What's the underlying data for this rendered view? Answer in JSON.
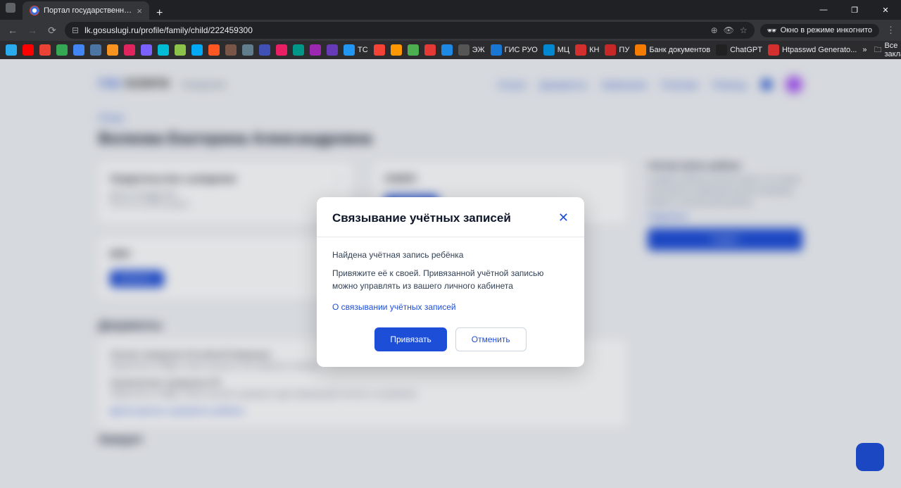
{
  "browser": {
    "tab_title": "Портал государственных услу",
    "url": "lk.gosuslugi.ru/profile/family/child/222459300",
    "incognito_label": "Окно в режиме инкогнито",
    "all_bookmarks": "Все закладки"
  },
  "bookmarks": [
    {
      "label": "",
      "color": "#2aabee"
    },
    {
      "label": "",
      "color": "#ff0000"
    },
    {
      "label": "",
      "color": "#ea4335"
    },
    {
      "label": "",
      "color": "#34a853"
    },
    {
      "label": "",
      "color": "#4285f4"
    },
    {
      "label": "",
      "color": "#4c75a3"
    },
    {
      "label": "",
      "color": "#f7931e"
    },
    {
      "label": "",
      "color": "#e0245e"
    },
    {
      "label": "",
      "color": "#7b61ff"
    },
    {
      "label": "",
      "color": "#00bcd4"
    },
    {
      "label": "",
      "color": "#8bc34a"
    },
    {
      "label": "",
      "color": "#03a9f4"
    },
    {
      "label": "",
      "color": "#ff5722"
    },
    {
      "label": "",
      "color": "#795548"
    },
    {
      "label": "",
      "color": "#607d8b"
    },
    {
      "label": "",
      "color": "#3f51b5"
    },
    {
      "label": "",
      "color": "#e91e63"
    },
    {
      "label": "",
      "color": "#009688"
    },
    {
      "label": "",
      "color": "#9c27b0"
    },
    {
      "label": "",
      "color": "#673ab7"
    },
    {
      "label": "TC",
      "color": "#2196f3"
    },
    {
      "label": "",
      "color": "#f44336"
    },
    {
      "label": "",
      "color": "#ff9800"
    },
    {
      "label": "",
      "color": "#4caf50"
    },
    {
      "label": "",
      "color": "#e53935"
    },
    {
      "label": "",
      "color": "#1e88e5"
    },
    {
      "label": "ЭЖ",
      "color": ""
    },
    {
      "label": "ГИС РУО",
      "color": "#1976d2"
    },
    {
      "label": "МЦ",
      "color": "#0288d1"
    },
    {
      "label": "КН",
      "color": "#d32f2f"
    },
    {
      "label": "ПУ",
      "color": "#c62828"
    },
    {
      "label": "Банк документов",
      "color": "#f57c00"
    },
    {
      "label": "ChatGPT",
      "color": "#212121"
    },
    {
      "label": "Htpasswd Generato...",
      "color": "#d32f2f"
    }
  ],
  "page": {
    "logo_p1": "ГОС",
    "logo_p2": "УСЛУГИ",
    "city": "Гражданам",
    "nav": [
      "Услуги",
      "Документы",
      "Заявления",
      "Платежи",
      "Помощь"
    ],
    "crumb": "Назад",
    "title": "Волкова Екатерина Александровна",
    "card_birth_title": "Свидетельство о рождении",
    "card_birth_label": "ДАТА РОЖДЕНИЯ",
    "card_birth_lines": "III-АН\n№ 123456\nвыдано",
    "card_snils_title": "СНИЛС",
    "card_snils_btn": "Добавить",
    "card_inn_title": "ИНН",
    "card_inn_btn": "Добавить",
    "section_docs": "Документы",
    "doc_line1": "Паспорт гражданина Российской Федерации",
    "doc_sub1": "Обратитесь в МВД, чтобы получить или заменить паспорт",
    "doc_line2": "Загранпаспорт гражданина РФ",
    "doc_sub2": "Обратитесь в МВД, чтобы получить документ удостоверяющий личность за рубежом",
    "doc_link": "Другие данные и документы ребёнка",
    "section_account": "Аккаунт",
    "right_title": "Учётная запись ребёнка",
    "right_text": "Создайте ребёнку учётную запись и он сможет пользоваться сервисами портала Например входить в электронный дневник",
    "right_link": "Подробнее",
    "right_btn": "Создать"
  },
  "modal": {
    "title": "Связывание учётных записей",
    "line1": "Найдена учётная запись ребёнка",
    "line2": "Привяжите её к своей. Привязанной учётной записью можно управлять из вашего личного кабинета",
    "link": "О связывании учётных записей",
    "primary": "Привязать",
    "secondary": "Отменить"
  }
}
